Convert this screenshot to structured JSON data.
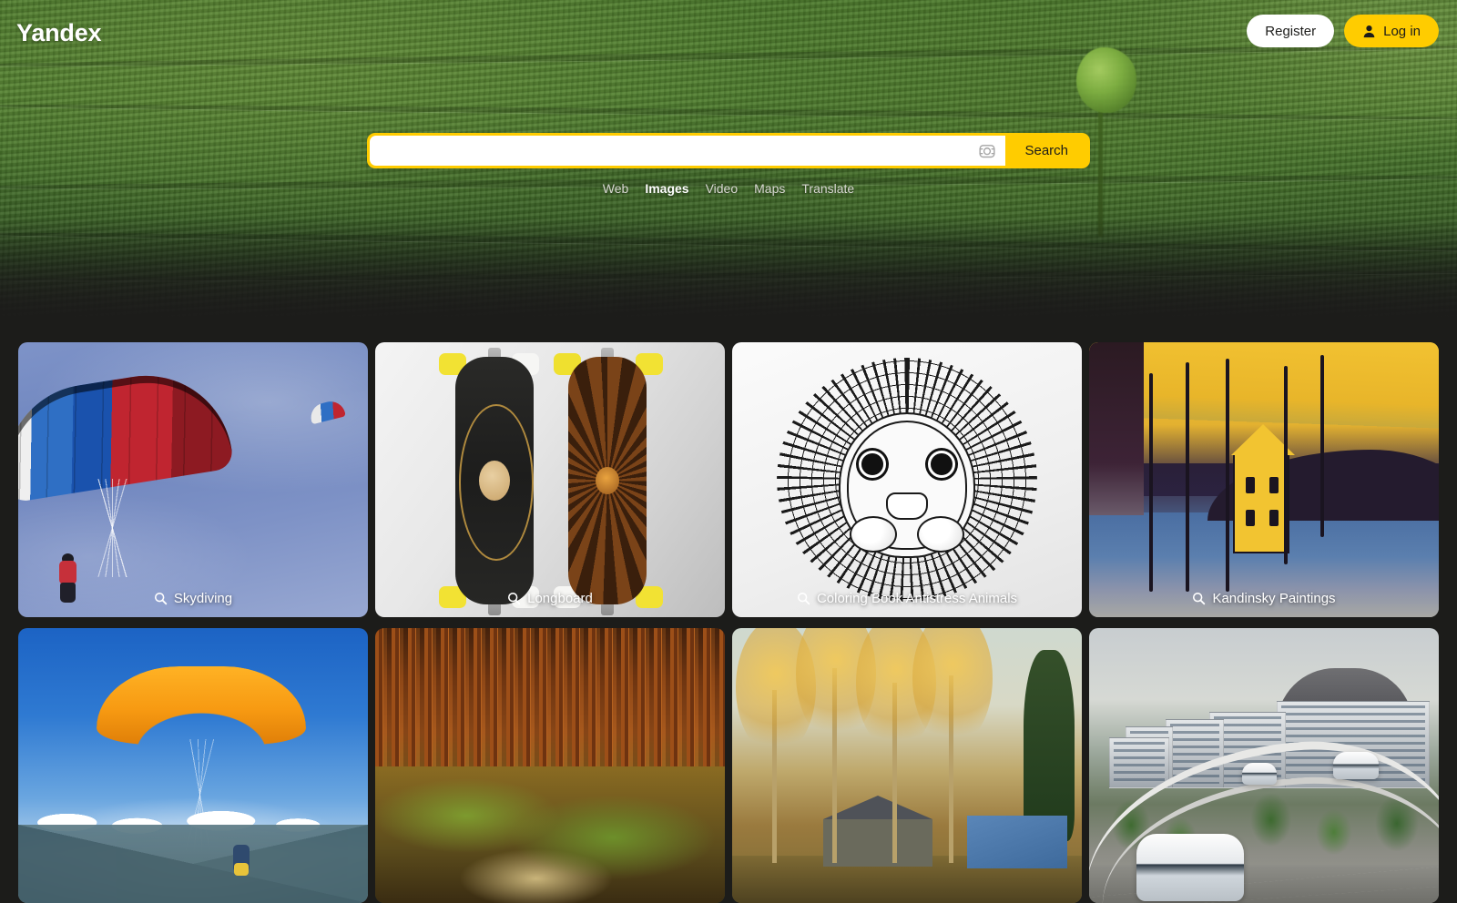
{
  "brand": {
    "logo": "Yandex"
  },
  "header": {
    "register_label": "Register",
    "login_label": "Log in",
    "login_icon": "user-icon"
  },
  "search": {
    "value": "",
    "placeholder": "",
    "button_label": "Search",
    "lens_icon": "camera-lens-search-icon"
  },
  "nav": {
    "tabs": [
      {
        "label": "Web",
        "active": false
      },
      {
        "label": "Images",
        "active": true
      },
      {
        "label": "Video",
        "active": false
      },
      {
        "label": "Maps",
        "active": false
      },
      {
        "label": "Translate",
        "active": false
      }
    ]
  },
  "grid": {
    "caption_icon": "magnifier-icon",
    "tiles": [
      {
        "label": "Skydiving"
      },
      {
        "label": "Longboard"
      },
      {
        "label": "Coloring Book Antistress Animals"
      },
      {
        "label": "Kandinsky Paintings"
      },
      {
        "label": ""
      },
      {
        "label": ""
      },
      {
        "label": ""
      },
      {
        "label": ""
      }
    ]
  },
  "colors": {
    "brand_yellow": "#ffcc00",
    "page_background": "#1c1c1a",
    "text_on_dark": "#ffffff"
  }
}
